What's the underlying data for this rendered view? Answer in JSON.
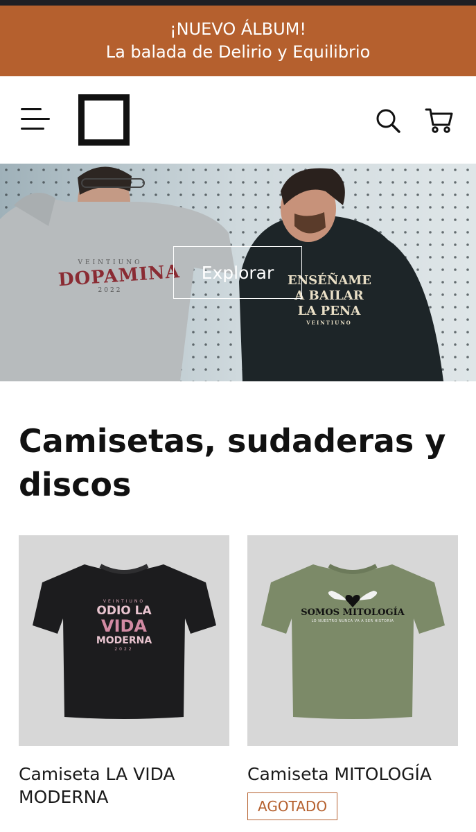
{
  "announcement": {
    "line1": "¡NUEVO ÁLBUM!",
    "line2": "La balada de Delirio y Equilibrio"
  },
  "header": {
    "icons": [
      "menu-icon",
      "logo",
      "search-icon",
      "cart-icon"
    ]
  },
  "hero": {
    "button_label": "Explorar",
    "hoodie_left_text": "DOPAMINA",
    "hoodie_left_small": "VEINTIUNO",
    "hoodie_left_year": "2022",
    "hoodie_right_text": [
      "ENSÉÑAME",
      "A BAILAR",
      "LA PENA"
    ],
    "hoodie_right_small": "VEINTIUNO"
  },
  "section": {
    "title": "Camisetas, sudaderas y discos"
  },
  "products": [
    {
      "name": "Camiseta LA VIDA MODERNA",
      "print_small_top": "VEINTIUNO",
      "print_lines": [
        "ODIO LA",
        "VIDA",
        "MODERNA"
      ],
      "print_small_bottom": "2022",
      "badge": ""
    },
    {
      "name": "Camiseta MITOLOGÍA",
      "print_main": "SOMOS MITOLOGÍA",
      "print_sub": "LO NUESTRO NUNCA VA A SER HISTORIA",
      "badge": "AGOTADO"
    }
  ],
  "colors": {
    "accent": "#b5602e",
    "shirt1": "#1c1c1e",
    "shirt2": "#7c8a68"
  }
}
